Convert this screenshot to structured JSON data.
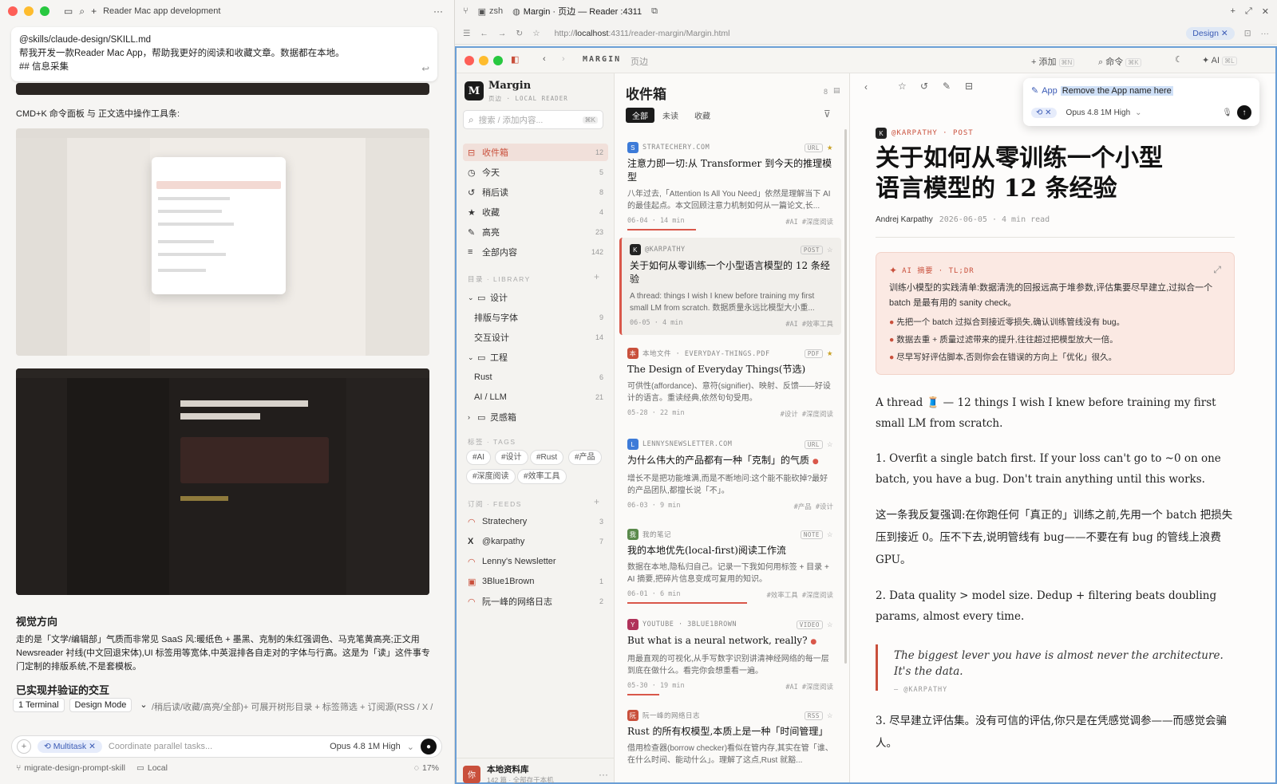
{
  "left_pane": {
    "window_title": "Reader Mac app development",
    "prompt_lines": [
      "@skills/claude-design/SKILL.md",
      "帮我开发一款Reader Mac App，帮助我更好的阅读和收藏文章。数据都在本地。",
      "## 信息采集"
    ],
    "caption_cmdk": "CMD+K 命令面板 与 正文选中操作工具条:",
    "visual_heading": "视觉方向",
    "visual_text": "走的是「文学/编辑部」气质而非常见 SaaS 风:暖纸色 + 墨黑、克制的朱红强调色、马克笔黄高亮;正文用 Newsreader 衬线(中文回退宋体),UI 标签用等宽体,中英混排各自走对的字体与行高。这是为「读」这件事专门定制的排版系统,不是套模板。",
    "verified_heading": "已实现并验证的交互",
    "verified_text": "/稍后读/收藏/高亮/全部)+ 可展开树形目录 + 标签筛选 + 订阅源(RSS / X /",
    "tabs": [
      "1 Terminal",
      "Design Mode"
    ],
    "input_chip": "Multitask",
    "input_placeholder": "Coordinate parallel tasks...",
    "model": "Opus 4.8 1M High",
    "branch": "migrate-design-prompt-skill",
    "location": "Local",
    "progress": "17%"
  },
  "browser": {
    "tabs": [
      "zsh",
      "Margin · 页边 — Reader :4311"
    ],
    "url_prefix": "http://",
    "url_host": "localhost",
    "url_path": ":4311/reader-margin/Margin.html",
    "design_chip": "Design"
  },
  "app": {
    "toolbar_title": "MARGIN",
    "toolbar_subtitle": "页边",
    "add_label": "添加",
    "add_kbd": "⌘N",
    "cmd_label": "命令",
    "cmd_kbd": "⌘K",
    "ai_label": "AI",
    "ai_kbd": "⌘L",
    "brand_name": "Margin",
    "brand_sub": "页边 · LOCAL READER",
    "search_placeholder": "搜索 / 添加内容...",
    "search_kbd": "⌘K",
    "nav": [
      {
        "label": "收件箱",
        "count": "12",
        "icon": "inbox-icon"
      },
      {
        "label": "今天",
        "count": "5",
        "icon": "clock-icon"
      },
      {
        "label": "稍后读",
        "count": "8",
        "icon": "history-icon"
      },
      {
        "label": "收藏",
        "count": "4",
        "icon": "star-icon"
      },
      {
        "label": "高亮",
        "count": "23",
        "icon": "pen-icon"
      },
      {
        "label": "全部内容",
        "count": "142",
        "icon": "list-icon"
      }
    ],
    "library_label": "目录 · LIBRARY",
    "folders": [
      {
        "label": "设计",
        "count": ""
      },
      {
        "label": "排版与字体",
        "count": "9"
      },
      {
        "label": "交互设计",
        "count": "14"
      },
      {
        "label": "工程",
        "count": ""
      },
      {
        "label": "Rust",
        "count": "6"
      },
      {
        "label": "AI / LLM",
        "count": "21"
      },
      {
        "label": "灵感箱",
        "count": ""
      }
    ],
    "tags_label": "标签 · TAGS",
    "tags": [
      "#AI",
      "#设计",
      "#Rust",
      "#产品",
      "#深度阅读",
      "#效率工具"
    ],
    "feeds_label": "订阅 · FEEDS",
    "feeds": [
      {
        "label": "Stratechery",
        "count": "3"
      },
      {
        "label": "@karpathy",
        "count": "7"
      },
      {
        "label": "Lenny's Newsletter",
        "count": ""
      },
      {
        "label": "3Blue1Brown",
        "count": "1"
      },
      {
        "label": "阮一峰的网络日志",
        "count": "2"
      }
    ],
    "footer_title": "本地资料库",
    "footer_sub": "142 篇 · 全部存于本机",
    "footer_avatar": "你"
  },
  "list": {
    "title": "收件箱",
    "count": "8",
    "filters": [
      "全部",
      "未读",
      "收藏"
    ],
    "cards": [
      {
        "fav": "S",
        "fav_color": "#3d7bd8",
        "source": "STRATECHERY.COM",
        "badge": "URL",
        "title": "注意力即一切:从 Transformer 到今天的推理模型",
        "excerpt": "八年过去,「Attention Is All You Need」依然是理解当下 AI 的最佳起点。本文回顾注意力机制如何从一篇论文,长...",
        "date": "06-04 · 14 min",
        "tags": "#AI #深度阅读"
      },
      {
        "fav": "K",
        "fav_color": "#222222",
        "source": "@KARPATHY",
        "badge": "POST",
        "title": "关于如何从零训练一个小型语言模型的 12 条经验",
        "excerpt": "A thread: things I wish I knew before training my first small LM from scratch. 数据质量永远比模型大小重...",
        "date": "06-05 · 4 min",
        "tags": "#AI #效率工具"
      },
      {
        "fav": "本",
        "fav_color": "#c9503c",
        "source": "本地文件 · EVERYDAY-THINGS.PDF",
        "badge": "PDF",
        "title": "The Design of Everyday Things(节选)",
        "excerpt": "可供性(affordance)、意符(signifier)、映射、反馈——好设计的语言。重读经典,依然句句受用。",
        "date": "05-28 · 22 min",
        "tags": "#设计 #深度阅读"
      },
      {
        "fav": "L",
        "fav_color": "#3d7bd8",
        "source": "LENNYSNEWSLETTER.COM",
        "badge": "URL",
        "title": "为什么伟大的产品都有一种「克制」的气质",
        "excerpt": "增长不是把功能堆满,而是不断地问:这个能不能砍掉?最好的产品团队,都擅长说「不」。",
        "date": "06-03 · 9 min",
        "tags": "#产品 #设计"
      },
      {
        "fav": "我",
        "fav_color": "#5a8a4c",
        "source": "我的笔记",
        "badge": "NOTE",
        "title": "我的本地优先(local-first)阅读工作流",
        "excerpt": "数据在本地,隐私归自己。记录一下我如何用标签 + 目录 + AI 摘要,把碎片信息变成可复用的知识。",
        "date": "06-01 · 6 min",
        "tags": "#效率工具 #深度阅读"
      },
      {
        "fav": "Y",
        "fav_color": "#b0325a",
        "source": "YOUTUBE · 3BLUE1BROWN",
        "badge": "VIDEO",
        "title": "But what is a neural network, really?",
        "excerpt": "用最直观的可视化,从手写数字识别讲清神经网络的每一层到底在做什么。看完你会想重看一遍。",
        "date": "05-30 · 19 min",
        "tags": "#AI #深度阅读"
      },
      {
        "fav": "阮",
        "fav_color": "#c9503c",
        "source": "阮一峰的网络日志",
        "badge": "RSS",
        "title": "Rust 的所有权模型,本质上是一种「时间管理」",
        "excerpt": "借用检查器(borrow checker)看似在管内存,其实在管「谁、在什么时间、能动什么」。理解了这点,Rust 就豁...",
        "date": "",
        "tags": ""
      }
    ]
  },
  "reader": {
    "popover_chip": "App",
    "popover_text": "Remove the App name here",
    "popover_model": "Opus 4.8 1M High",
    "source": "@KARPATHY · POST",
    "title": "关于如何从零训练一个小型语言模型的 12 条经验",
    "author": "Andrej Karpathy",
    "meta": "2026-06-05 · 4 min read",
    "ai_label": "AI 摘要 · TL;DR",
    "ai_summary": "训练小模型的实践清单:数据清洗的回报远高于堆参数,评估集要尽早建立,过拟合一个 batch 是最有用的 sanity check。",
    "ai_points": [
      "先把一个 batch 过拟合到接近零损失,确认训练管线没有 bug。",
      "数据去重 + 质量过滤带来的提升,往往超过把模型放大一倍。",
      "尽早写好评估脚本,否则你会在错误的方向上「优化」很久。"
    ],
    "p1": "A thread 🧵 — 12 things I wish I knew before training my first small LM from scratch.",
    "p2": "1. Overfit a single batch first. If your loss can't go to ~0 on one batch, you have a bug. Don't train anything until this works.",
    "p3": "这一条我反复强调:在你跑任何「真正的」训练之前,先用一个 batch 把损失压到接近 0。压不下去,说明管线有 bug——不要在有 bug 的管线上浪费 GPU。",
    "p4": "2. Data quality > model size. Dedup + filtering beats doubling params, almost every time.",
    "quote": "The biggest lever you have is almost never the architecture. It's the data.",
    "quote_attr": "— @KARPATHY",
    "p5": "3. 尽早建立评估集。没有可信的评估,你只是在凭感觉调参——而感觉会骗人。"
  },
  "colors": {
    "accent": "#c9503c",
    "highlight_bar": "#d9574a",
    "focus_border": "#6b9fd6"
  }
}
